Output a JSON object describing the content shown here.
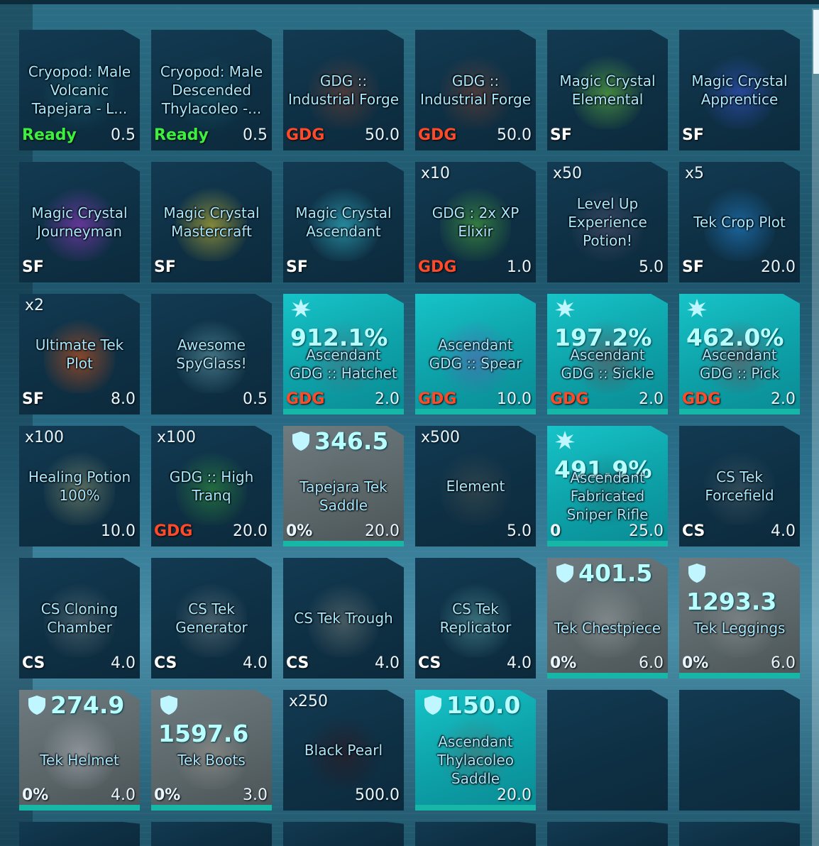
{
  "colors": {
    "ready": "#3df03d",
    "gdg": "#ff4a2a",
    "sf": "#ffffff",
    "cs": "#ffffff",
    "teal_slot": "#10b0b8",
    "grey_slot": "#5e6a6e",
    "underline": "#16b7a7"
  },
  "inventory": {
    "slots": [
      {
        "name": "Cryopod: Male Volcanic Tapejara - L...",
        "tag": "Ready",
        "tag_color": "ready",
        "weight": "0.5",
        "icon": "cryopod-icon"
      },
      {
        "name": "Cryopod: Male Descended Thylacoleo -...",
        "tag": "Ready",
        "tag_color": "ready",
        "weight": "0.5",
        "icon": "cryopod-icon"
      },
      {
        "name": "GDG :: Industrial Forge",
        "tag": "GDG",
        "tag_color": "gdg",
        "weight": "50.0",
        "icon": "forge-icon"
      },
      {
        "name": "GDG :: Industrial Forge",
        "tag": "GDG",
        "tag_color": "gdg",
        "weight": "50.0",
        "icon": "forge-icon"
      },
      {
        "name": "Magic Crystal Elemental",
        "tag": "SF",
        "tag_color": "sf",
        "weight": "",
        "icon": "green-crystal-icon"
      },
      {
        "name": "Magic Crystal Apprentice",
        "tag": "SF",
        "tag_color": "sf",
        "weight": "",
        "icon": "blue-crystal-icon"
      },
      {
        "name": "Magic Crystal Journeyman",
        "tag": "SF",
        "tag_color": "sf",
        "weight": "",
        "icon": "purple-crystal-icon"
      },
      {
        "name": "Magic Crystal Mastercraft",
        "tag": "SF",
        "tag_color": "sf",
        "weight": "",
        "icon": "yellow-crystal-icon"
      },
      {
        "name": "Magic Crystal Ascendant",
        "tag": "SF",
        "tag_color": "sf",
        "weight": "",
        "icon": "cyan-crystal-icon"
      },
      {
        "qty": "x10",
        "name": "GDG : 2x XP Elixir",
        "tag": "GDG",
        "tag_color": "gdg",
        "weight": "1.0",
        "icon": "elixir-flask-icon"
      },
      {
        "qty": "x50",
        "name": "Level Up Experience Potion!",
        "tag": "",
        "weight": "5.0",
        "icon": "potion-icon"
      },
      {
        "qty": "x5",
        "name": "Tek Crop Plot",
        "tag": "SF",
        "tag_color": "sf",
        "weight": "20.0",
        "icon": "tek-crop-plot-icon"
      },
      {
        "qty": "x2",
        "name": "Ultimate Tek Plot",
        "tag": "SF",
        "tag_color": "sf",
        "weight": "8.0",
        "icon": "ultimate-tek-plot-icon"
      },
      {
        "name": "Awesome SpyGlass!",
        "tag": "",
        "weight": "0.5",
        "icon": "spyglass-icon"
      },
      {
        "stat": "912.1%",
        "stat_icon": "burst",
        "name": "Ascendant GDG :: Hatchet",
        "tag": "GDG",
        "tag_color": "gdg",
        "weight": "2.0",
        "style": "teal",
        "icon": "hatchet-icon"
      },
      {
        "name": "Ascendant GDG :: Spear",
        "tag": "GDG",
        "tag_color": "gdg",
        "weight": "10.0",
        "style": "teal",
        "icon": "spear-icon"
      },
      {
        "stat": "197.2%",
        "stat_icon": "burst",
        "name": "Ascendant GDG :: Sickle",
        "tag": "GDG",
        "tag_color": "gdg",
        "weight": "2.0",
        "style": "teal",
        "icon": "sickle-icon"
      },
      {
        "stat": "462.0%",
        "stat_icon": "burst",
        "name": "Ascendant GDG :: Pick",
        "tag": "GDG",
        "tag_color": "gdg",
        "weight": "2.0",
        "style": "teal",
        "icon": "pick-icon"
      },
      {
        "qty": "x100",
        "name": "Healing Potion 100%",
        "tag": "",
        "weight": "10.0",
        "icon": "healing-potion-icon"
      },
      {
        "qty": "x100",
        "name": "GDG :: High Tranq",
        "tag": "GDG",
        "tag_color": "gdg",
        "weight": "20.0",
        "icon": "tranq-dart-icon"
      },
      {
        "stat": "346.5",
        "stat_icon": "shield",
        "name": "Tapejara Tek Saddle",
        "pct": "0%",
        "weight": "20.0",
        "style": "grey",
        "icon": "saddle-icon"
      },
      {
        "qty": "x500",
        "name": "Element",
        "tag": "",
        "weight": "5.0",
        "icon": "element-icon"
      },
      {
        "stat": "491.9%",
        "stat_icon": "burst",
        "name": "Ascendant Fabricated Sniper Rifle",
        "pct": "0",
        "weight": "25.0",
        "style": "teal",
        "icon": "sniper-rifle-icon"
      },
      {
        "name": "CS Tek Forcefield",
        "tag": "CS",
        "tag_color": "cs",
        "weight": "4.0",
        "icon": "forcefield-icon"
      },
      {
        "name": "CS Cloning Chamber",
        "tag": "CS",
        "tag_color": "cs",
        "weight": "4.0",
        "icon": "cloning-chamber-icon"
      },
      {
        "name": "CS Tek Generator",
        "tag": "CS",
        "tag_color": "cs",
        "weight": "4.0",
        "icon": "tek-generator-icon"
      },
      {
        "name": "CS Tek Trough",
        "tag": "CS",
        "tag_color": "cs",
        "weight": "4.0",
        "icon": "tek-trough-icon"
      },
      {
        "name": "CS Tek Replicator",
        "tag": "CS",
        "tag_color": "cs",
        "weight": "4.0",
        "icon": "tek-replicator-icon"
      },
      {
        "stat": "401.5",
        "stat_icon": "shield",
        "name": "Tek Chestpiece",
        "pct": "0%",
        "weight": "6.0",
        "style": "grey",
        "icon": "chestpiece-icon"
      },
      {
        "stat": "1293.3",
        "stat_icon": "shield",
        "name": "Tek Leggings",
        "pct": "0%",
        "weight": "6.0",
        "style": "grey",
        "icon": "leggings-icon"
      },
      {
        "stat": "274.9",
        "stat_icon": "shield",
        "name": "Tek Helmet",
        "pct": "0%",
        "weight": "4.0",
        "style": "grey",
        "icon": "helmet-icon"
      },
      {
        "stat": "1597.6",
        "stat_icon": "shield",
        "name": "Tek Boots",
        "pct": "0%",
        "weight": "3.0",
        "style": "grey",
        "icon": "boots-icon"
      },
      {
        "qty": "x250",
        "name": "Black Pearl",
        "tag": "",
        "weight": "500.0",
        "icon": "black-pearl-icon"
      },
      {
        "stat": "150.0",
        "stat_icon": "shield",
        "name": "Ascendant Thylacoleo Saddle",
        "weight": "20.0",
        "style": "teal",
        "icon": "saddle-icon"
      },
      {
        "empty": true
      },
      {
        "empty": true
      }
    ]
  }
}
